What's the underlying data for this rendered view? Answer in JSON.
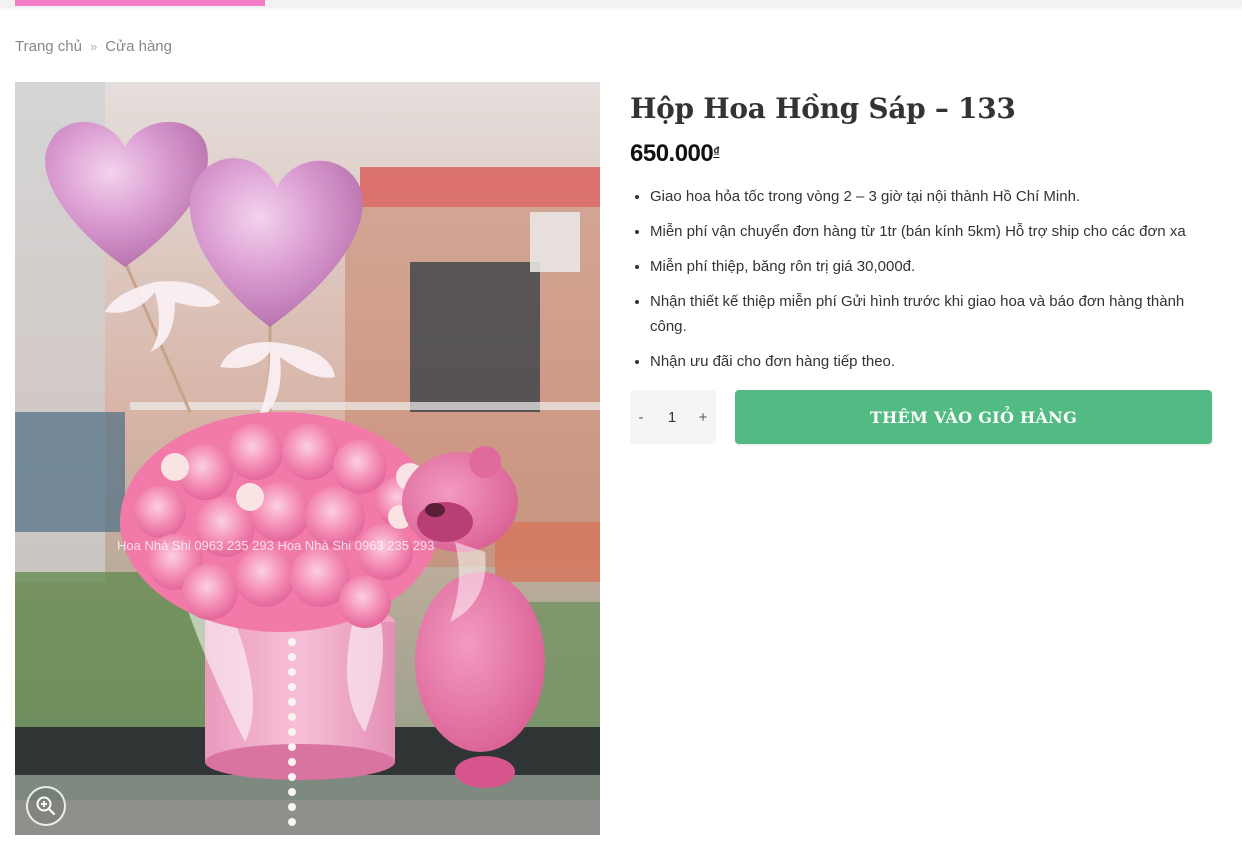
{
  "breadcrumb": {
    "home": "Trang chủ",
    "separator": "»",
    "shop": "Cửa hàng"
  },
  "product": {
    "title": "Hộp Hoa Hồng Sáp – 133",
    "price": "650.000",
    "currency_symbol": "₫",
    "features": [
      "Giao hoa hỏa tốc trong vòng 2 – 3 giờ tại nội thành Hồ Chí Minh.",
      "Miễn phí vận chuyển đơn hàng từ 1tr (bán kính 5km) Hỗ trợ ship cho các đơn xa",
      "Miễn phí thiệp, băng rôn trị giá 30,000đ.",
      "Nhận thiết kế thiệp miễn phí Gửi hình trước khi giao hoa và báo đơn hàng thành công.",
      "Nhận ưu đãi cho đơn hàng tiếp theo."
    ],
    "image": {
      "watermark": "Hoa Nhà Shi 0963 235 293 Hoa Nhà Shi 0963 235 293",
      "zoom_icon": "zoom-icon"
    }
  },
  "cart": {
    "minus_label": "-",
    "quantity": "1",
    "plus_label": "+",
    "add_label": "THÊM VÀO GIỎ HÀNG"
  },
  "colors": {
    "accent_pink": "#f47cc8",
    "button_green": "#52bb84",
    "text_dark": "#333333"
  }
}
